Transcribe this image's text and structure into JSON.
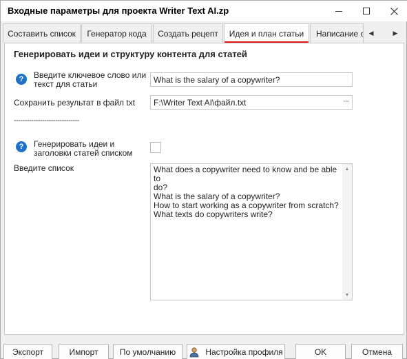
{
  "window": {
    "title": "Входные параметры для проекта Writer Text AI.zp"
  },
  "tabs": [
    {
      "label": "Составить список"
    },
    {
      "label": "Генератор кода"
    },
    {
      "label": "Создать рецепт"
    },
    {
      "label": "Идея и план статьи"
    },
    {
      "label": "Написание ст"
    }
  ],
  "panel": {
    "heading": "Генерировать идеи и структуру контента для статей",
    "keyword": {
      "label": "Введите ключевое слово или текст для статьи",
      "value": "What is the salary of a copywriter?"
    },
    "save_file": {
      "label": "Сохранить результат в файл txt",
      "value": "F:\\Writer Text AI\\файл.txt",
      "browse": "···"
    },
    "divider": "------------------------------",
    "generate_list": {
      "label": "Генерировать идеи и заголовки статей списком",
      "checked": false
    },
    "list": {
      "label": "Введите список",
      "lines": [
        "What does a copywriter need to know and be able to",
        "do?",
        "What is the salary of a copywriter?",
        "How to start working as a copywriter from scratch?",
        "What texts do copywriters write?"
      ]
    }
  },
  "footer": {
    "export": "Экспорт",
    "import": "Импорт",
    "defaults": "По умолчанию",
    "profile": "Настройка профиля",
    "ok": "OK",
    "cancel": "Отмена"
  },
  "colors": {
    "accent_underline": "#e01515",
    "help_icon": "#1e73c8"
  }
}
